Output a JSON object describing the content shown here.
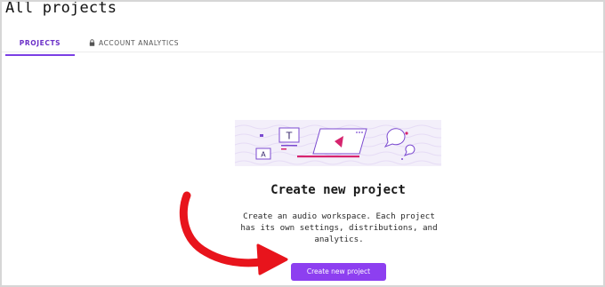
{
  "header": {
    "title": "All projects"
  },
  "tabs": [
    {
      "label": "PROJECTS",
      "active": true
    },
    {
      "label": "ACCOUNT ANALYTICS",
      "active": false,
      "icon": "lock-icon"
    }
  ],
  "empty_state": {
    "heading": "Create new project",
    "description": "Create an audio workspace. Each project has its own settings, distributions, and analytics.",
    "button_label": "Create new project",
    "illustration_letters": [
      "T",
      "A"
    ]
  },
  "colors": {
    "accent": "#8d3ff0",
    "tab_active": "#6a2fc7",
    "illustration_bg": "#f3effa",
    "illustration_line": "#7b4ad0",
    "illustration_pink": "#d6246e",
    "annotation_arrow": "#e8141c"
  }
}
